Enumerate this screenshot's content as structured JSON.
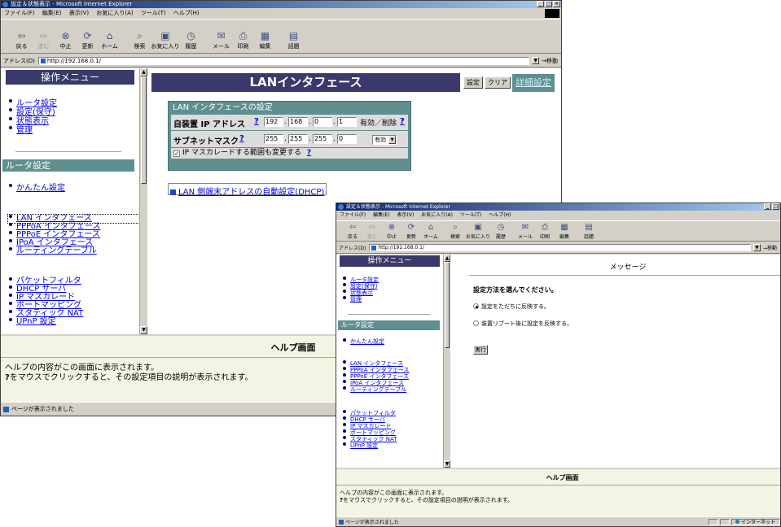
{
  "window1": {
    "title": "設定＆状態表示 - Microsoft Internet Explorer",
    "menu": [
      "ファイル(F)",
      "編集(E)",
      "表示(V)",
      "お気に入り(A)",
      "ツール(T)",
      "ヘルプ(H)"
    ],
    "toolbar": [
      {
        "icon": "back-arrow-icon",
        "glyph": "⇦",
        "label": "戻る"
      },
      {
        "icon": "forward-arrow-icon",
        "glyph": "⇨",
        "label": "進む"
      },
      {
        "icon": "stop-icon",
        "glyph": "⊗",
        "label": "中止"
      },
      {
        "icon": "refresh-icon",
        "glyph": "⟳",
        "label": "更新"
      },
      {
        "icon": "home-icon",
        "glyph": "⌂",
        "label": "ホーム"
      },
      {
        "icon": "search-icon",
        "glyph": "⌕",
        "label": "検索"
      },
      {
        "icon": "favorites-icon",
        "glyph": "▣",
        "label": "お気に入り"
      },
      {
        "icon": "history-icon",
        "glyph": "◷",
        "label": "履歴"
      },
      {
        "icon": "mail-icon",
        "glyph": "✉",
        "label": "メール"
      },
      {
        "icon": "print-icon",
        "glyph": "⎙",
        "label": "印刷"
      },
      {
        "icon": "edit-icon",
        "glyph": "▦",
        "label": "編集"
      },
      {
        "icon": "discuss-icon",
        "glyph": "▤",
        "label": "話題"
      }
    ],
    "address_label": "アドレス(D)",
    "address_value": "http://192.168.0.1/",
    "go_label": "移動",
    "left_menu_title": "操作メニュー",
    "top_links": [
      "ルータ設定",
      "設定(保守)",
      "状態表示",
      "管理"
    ],
    "router_section": "ルータ設定",
    "simple_setup": "かんたん設定",
    "interface_links": [
      "LAN インタフェース",
      "PPPoA インタフェース",
      "PPPoE インタフェース",
      "IPoA インタフェース",
      "ルーティングテーブル"
    ],
    "filter_links": [
      "パケットフィルタ",
      "DHCP サーバ",
      "IP マスカレード",
      "ポートマッピング",
      "スタティック NAT",
      "UPnP 設定"
    ],
    "page_title": "LANインタフェース",
    "btn_set": "設定",
    "btn_clear": "クリア",
    "detail_link": "詳細設定",
    "lan_box_title": "LAN インタフェースの設定",
    "ip_label": "自装置 IP アドレス",
    "ip_octets": [
      "192",
      "168",
      "0",
      "1"
    ],
    "enable_delete": "有効／削除",
    "subnet_label": "サブネットマスク",
    "mask_octets": [
      "255",
      "255",
      "255",
      "0"
    ],
    "enable_select": "有効",
    "masq_checkbox": "IP マスカレードする範囲も変更する",
    "help_q": "?",
    "dhcp_link": "LAN 側端末アドレスの自動設定(DHCP)",
    "help_title": "ヘルプ画面",
    "help_line1": "ヘルプの内容がこの画面に表示されます。",
    "help_line2": "をマウスでクリックすると、その設定項目の説明が表示されます。",
    "help_line2_q": "?",
    "status_text": "ページが表示されました"
  },
  "window2": {
    "title": "設定＆状態表示 - Microsoft Internet Explorer",
    "menu": [
      "ファイル(F)",
      "編集(E)",
      "表示(V)",
      "お気に入り(A)",
      "ツール(T)",
      "ヘルプ(H)"
    ],
    "address_label": "アドレス(D)",
    "address_value": "http://192.168.0.1/",
    "go_label": "移動",
    "left_menu_title": "操作メニュー",
    "top_links": [
      "ルータ設定",
      "設定(保守)",
      "状態表示",
      "管理"
    ],
    "router_section": "ルータ設定",
    "simple_setup": "かんたん設定",
    "interface_links": [
      "LAN インタフェース",
      "PPPoA インタフェース",
      "PPPoE インタフェース",
      "IPoA インタフェース",
      "ルーティングテーブル"
    ],
    "filter_links": [
      "パケットフィルタ",
      "DHCP サーバ",
      "IP マスカレード",
      "ポートマッピング",
      "スタティック NAT",
      "UPnP 設定"
    ],
    "message_title": "メッセージ",
    "prompt": "設定方法を選んでください。",
    "option1": "設定をただちに反映する。",
    "option2": "装置リブート後に設定を反映する。",
    "exec_button": "実行",
    "help_title": "ヘルプ画面",
    "help_line1": "ヘルプの内容がこの画面に表示されます。",
    "help_line2": "をマウスでクリックすると、その設定項目の説明が表示されます。",
    "help_line2_q": "?",
    "status_text": "ページが表示されました",
    "zone_text": "インターネット"
  },
  "colors": {
    "title_bar": "#0a246a",
    "menu_title_bg": "#39396b",
    "section_teal": "#5f8f8f",
    "link": "#0000ee",
    "help_bg": "#f3f5e4"
  }
}
